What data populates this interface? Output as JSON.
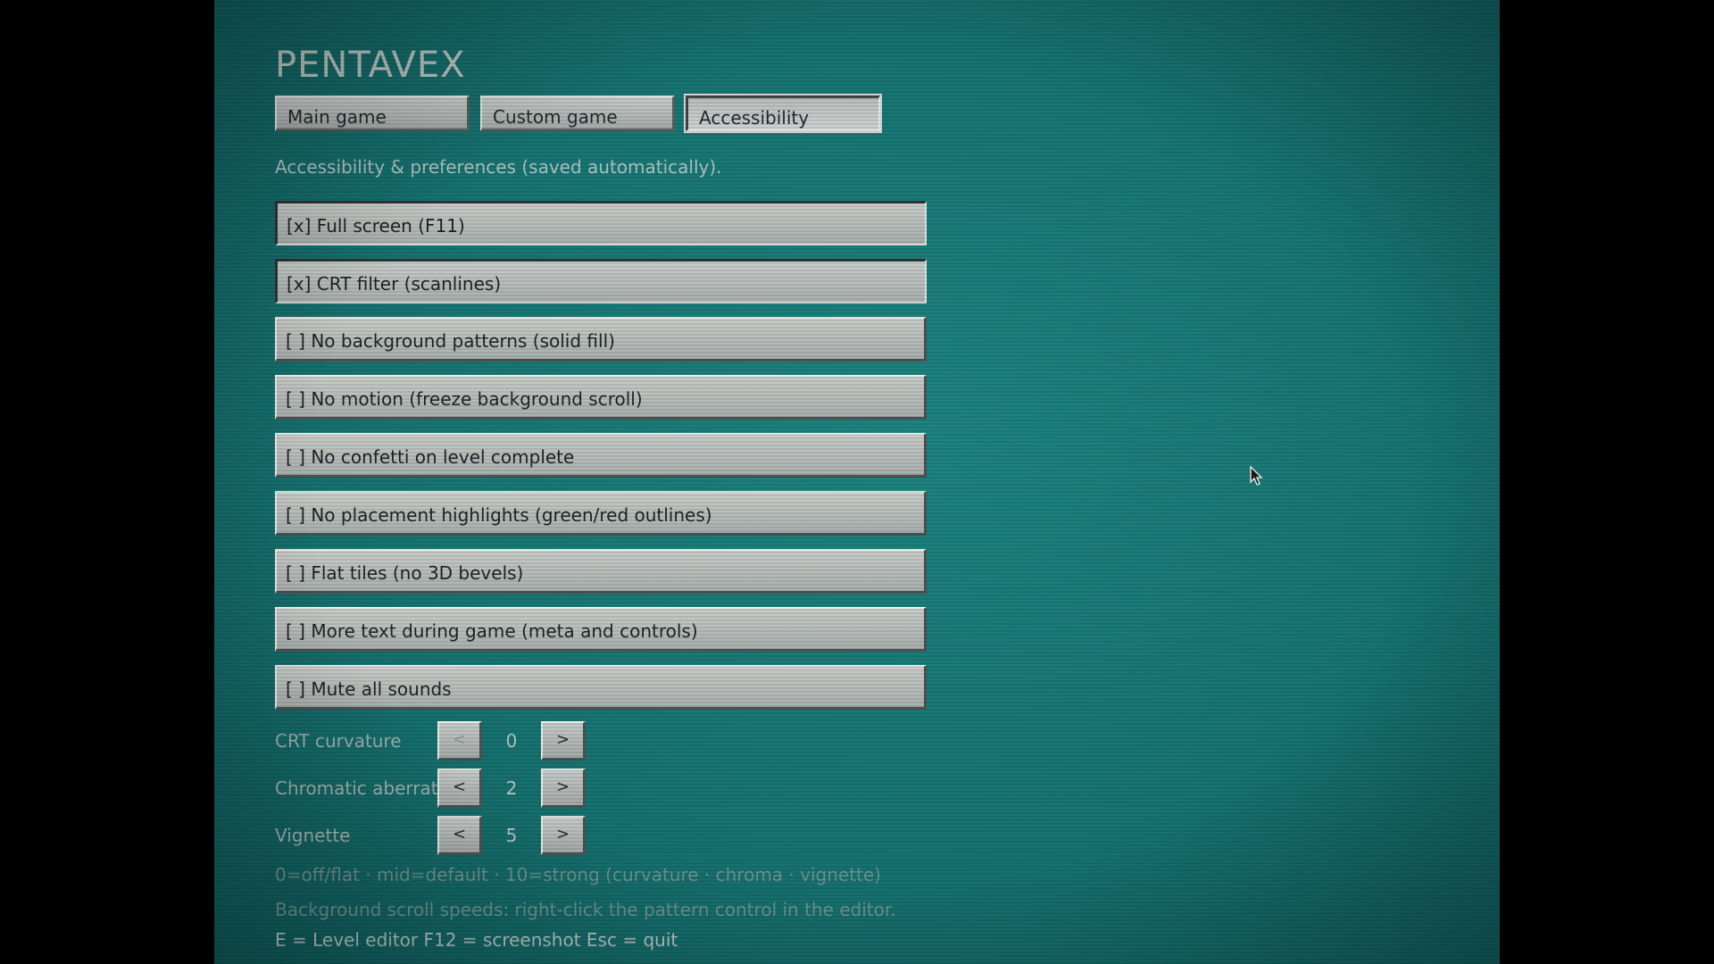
{
  "app": {
    "title": "PENTAVEX"
  },
  "tabs": [
    {
      "label": "Main game",
      "active": false
    },
    {
      "label": "Custom game",
      "active": false
    },
    {
      "label": "Accessibility",
      "active": true
    }
  ],
  "subtitle": "Accessibility & preferences (saved automatically).",
  "options": [
    {
      "label": "[x] Full screen (F11)",
      "checked": true
    },
    {
      "label": "[x] CRT filter (scanlines)",
      "checked": true
    },
    {
      "label": "[ ] No background patterns (solid fill)",
      "checked": false
    },
    {
      "label": "[ ] No motion (freeze background scroll)",
      "checked": false
    },
    {
      "label": "[ ] No confetti on level complete",
      "checked": false
    },
    {
      "label": "[ ] No placement highlights (green/red outlines)",
      "checked": false
    },
    {
      "label": "[ ] Flat tiles (no 3D bevels)",
      "checked": false
    },
    {
      "label": "[ ] More text during game (meta and controls)",
      "checked": false
    },
    {
      "label": "[ ] Mute all sounds",
      "checked": false
    }
  ],
  "sliders": [
    {
      "label": "CRT curvature",
      "value": "0",
      "dec_label": "<",
      "inc_label": ">"
    },
    {
      "label": "Chromatic aberration",
      "value": "2",
      "dec_label": "<",
      "inc_label": ">"
    },
    {
      "label": "Vignette",
      "value": "5",
      "dec_label": "<",
      "inc_label": ">"
    }
  ],
  "hints": {
    "scale": "0=off/flat · mid=default · 10=strong  (curvature · chroma · vignette)",
    "scroll": "Background scroll speeds: right-click the pattern control in the editor.",
    "keys": "E = Level editor    F12 = screenshot    Esc = quit"
  },
  "colors": {
    "background": "#177472",
    "panel": "#bfc4c2",
    "border_dark": "#4d5352"
  }
}
